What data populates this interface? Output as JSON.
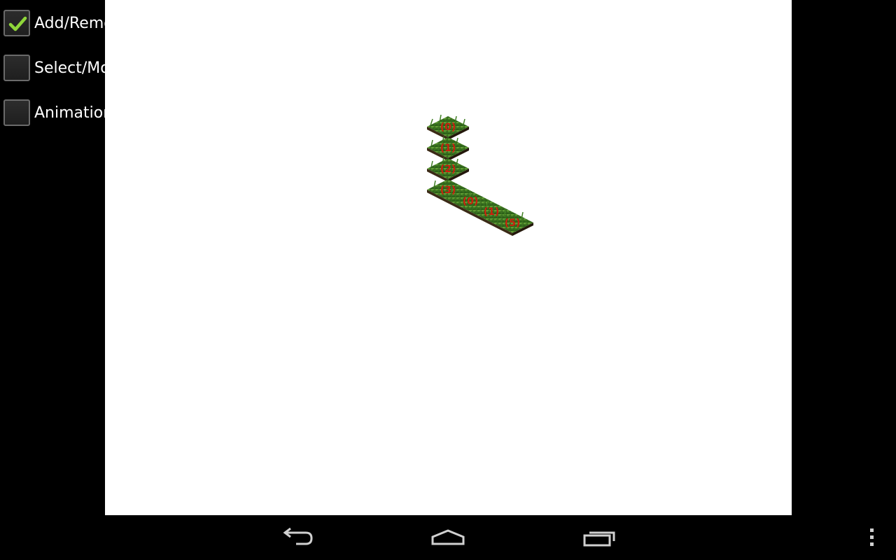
{
  "controls": {
    "checkboxes": [
      {
        "label": "Add/Remove",
        "checked": true
      },
      {
        "label": "Select/Move",
        "checked": false
      },
      {
        "label": "Animation",
        "checked": false
      }
    ]
  },
  "scene": {
    "tiles": [
      {
        "label": "(0)"
      },
      {
        "label": "(1)"
      },
      {
        "label": "(2)"
      },
      {
        "label": "(3)"
      },
      {
        "label": "(0)"
      },
      {
        "label": "(1)"
      },
      {
        "label": "(5)"
      }
    ],
    "tile_texture": "grass",
    "background_color": "#ffffff",
    "label_color": "#cc1f0e"
  },
  "nav_bar": {
    "buttons": [
      {
        "name": "back-icon"
      },
      {
        "name": "home-icon"
      },
      {
        "name": "recent-apps-icon"
      },
      {
        "name": "overflow-menu-icon"
      }
    ]
  },
  "colors": {
    "check_mark": "#8fd63a",
    "nav_icon": "#d0d0d0",
    "window_background": "#000000"
  }
}
